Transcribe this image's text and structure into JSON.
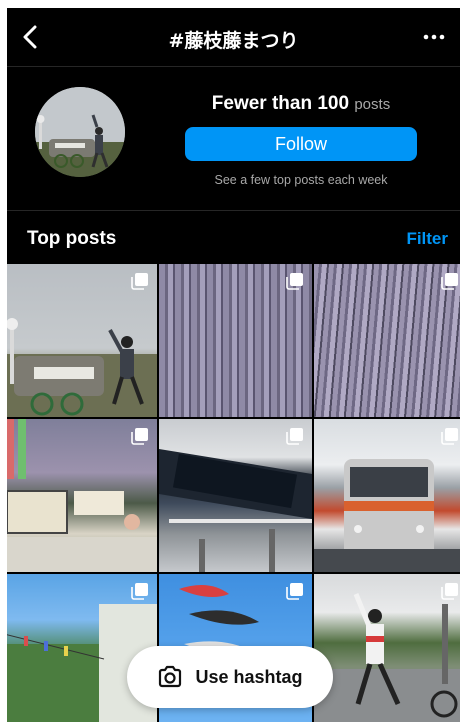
{
  "topbar": {
    "title": "#藤枝藤まつり",
    "back_icon": "chevron-left-icon",
    "more_icon": "more-horizontal-icon"
  },
  "header": {
    "post_count": "Fewer than 100",
    "post_count_unit": "posts",
    "follow_label": "Follow",
    "subtitle": "See a few top posts each week"
  },
  "section": {
    "title": "Top posts",
    "filter_label": "Filter"
  },
  "grid": {
    "tiles": [
      {
        "name": "post-1",
        "multi": true
      },
      {
        "name": "post-2",
        "multi": true
      },
      {
        "name": "post-3",
        "multi": true
      },
      {
        "name": "post-4",
        "multi": true
      },
      {
        "name": "post-5",
        "multi": true
      },
      {
        "name": "post-6",
        "multi": true
      },
      {
        "name": "post-7",
        "multi": true
      },
      {
        "name": "post-8",
        "multi": true
      },
      {
        "name": "post-9",
        "multi": true
      }
    ]
  },
  "fab": {
    "label": "Use hashtag",
    "icon": "camera-icon"
  },
  "colors": {
    "accent": "#0095f6",
    "background": "#000000",
    "muted": "#a8a8a8"
  }
}
